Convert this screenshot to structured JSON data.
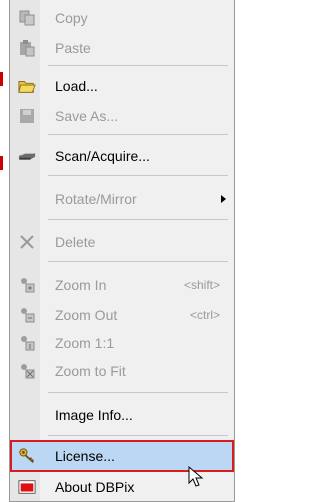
{
  "menu": {
    "items": [
      {
        "label": "Copy",
        "icon": "copy-icon",
        "enabled": false
      },
      {
        "label": "Paste",
        "icon": "paste-icon",
        "enabled": false
      },
      {
        "label": "Load...",
        "icon": "folder-open-icon",
        "enabled": true
      },
      {
        "label": "Save As...",
        "icon": "save-icon",
        "enabled": false
      },
      {
        "label": "Scan/Acquire...",
        "icon": "scanner-icon",
        "enabled": true
      },
      {
        "label": "Rotate/Mirror",
        "icon": "",
        "enabled": false
      },
      {
        "label": "Delete",
        "icon": "delete-icon",
        "enabled": false
      },
      {
        "label": "Zoom In",
        "icon": "zoom-in-icon",
        "enabled": false,
        "shortcut": "<shift>"
      },
      {
        "label": "Zoom Out",
        "icon": "zoom-out-icon",
        "enabled": false,
        "shortcut": "<ctrl>"
      },
      {
        "label": "Zoom 1:1",
        "icon": "zoom-actual-icon",
        "enabled": false
      },
      {
        "label": "Zoom to Fit",
        "icon": "zoom-fit-icon",
        "enabled": false
      },
      {
        "label": "Image Info...",
        "icon": "",
        "enabled": true
      },
      {
        "label": "License...",
        "icon": "license-key-icon",
        "enabled": true
      },
      {
        "label": "About DBPix",
        "icon": "about-icon",
        "enabled": true
      }
    ]
  },
  "colors": {
    "highlight": "#bcd7f3",
    "highlight_border": "#d81b1b",
    "disabled_text": "#9a9a9a"
  }
}
